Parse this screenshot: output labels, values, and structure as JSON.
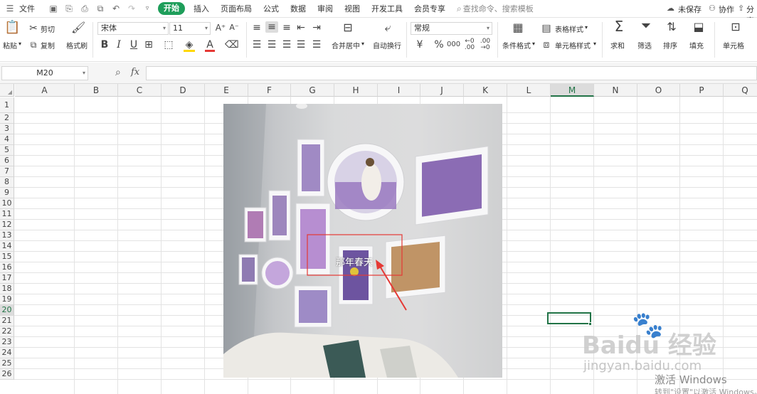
{
  "menubar": {
    "file": "文件",
    "tabs": [
      "开始",
      "插入",
      "页面布局",
      "公式",
      "数据",
      "审阅",
      "视图",
      "开发工具",
      "会员专享"
    ],
    "search_placeholder": "查找命令、搜索模板",
    "unsaved": "未保存",
    "collab": "协作",
    "share": "分享"
  },
  "ribbon": {
    "paste": "粘贴",
    "cut": "剪切",
    "copy": "复制",
    "format_painter": "格式刷",
    "font_name": "宋体",
    "font_size": "11",
    "merge_center": "合并居中",
    "wrap_text": "自动换行",
    "number_format": "常规",
    "cond_format": "条件格式",
    "table_style": "表格样式",
    "cell_style": "单元格样式",
    "sum": "求和",
    "filter": "筛选",
    "sort": "排序",
    "fill": "填充",
    "cell": "单元格"
  },
  "formula_bar": {
    "name_box": "M20",
    "fx": "fx",
    "value": ""
  },
  "grid": {
    "columns": [
      "A",
      "B",
      "C",
      "D",
      "E",
      "F",
      "G",
      "H",
      "I",
      "J",
      "K",
      "L",
      "M",
      "N",
      "O",
      "P",
      "Q"
    ],
    "rows": [
      "1",
      "2",
      "3",
      "4",
      "5",
      "6",
      "7",
      "8",
      "9",
      "10",
      "11",
      "12",
      "13",
      "14",
      "15",
      "16",
      "17",
      "18",
      "19",
      "20",
      "21",
      "22",
      "23",
      "24",
      "25",
      "26"
    ],
    "selected_col": "M",
    "selected_row": "20"
  },
  "image": {
    "caption": "那年春天"
  },
  "watermark": {
    "baidu": "Baidu 经验",
    "url": "jingyan.baidu.com",
    "activate": "激活 Windows",
    "activate_sub": "转到\"设置\"以激活 Windows。"
  },
  "colors": {
    "accent": "#1e9e5a",
    "selection": "#217346",
    "annotation": "#e53935"
  }
}
